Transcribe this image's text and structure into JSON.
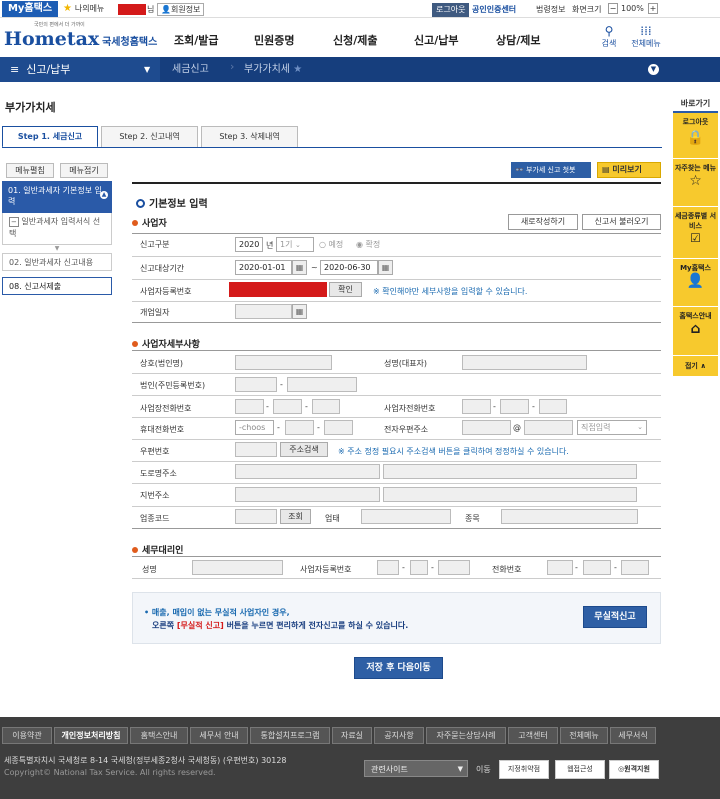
{
  "topbar": {
    "mytax": "My홈택스",
    "mymenu": "나의메뉴",
    "user_suffix": "님",
    "member_info": "회원정보",
    "logout": "로그아웃",
    "cert_center": "공인인증센터",
    "prev_info": "법령정보",
    "screen_size": "화면크기",
    "zoom": "100%"
  },
  "logo": {
    "tagline": "국민의 편에서 더 가까이",
    "brand": "Hometax",
    "org": "국세청홈택스"
  },
  "main_nav": [
    "조회/발급",
    "민원증명",
    "신청/제출",
    "신고/납부",
    "상담/제보"
  ],
  "util": {
    "search": "검색",
    "all_menu": "전체메뉴"
  },
  "breadcrumb": {
    "menu_icon": "≡",
    "level1": "신고/납부",
    "level2": "세금신고",
    "level3": "부가가치세"
  },
  "page_title": "부가가치세",
  "tabs": [
    "Step 1. 세금신고",
    "Step 2. 신고내역",
    "Step 3. 삭제내역"
  ],
  "side": {
    "expand": "메뉴펼침",
    "collapse": "메뉴접기",
    "items": [
      "01. 일반과세자 기본정보 입력",
      "일반과세자 입력서식 선택",
      "02. 일반과세자 신고내용",
      "08. 신고서제출"
    ]
  },
  "actions": {
    "guide": "부가세 신고 첫봇",
    "preview": "미리보기"
  },
  "basic": {
    "title": "기본정보 입력",
    "business_title": "사업자",
    "new_write": "새로작성하기",
    "load_report": "신고서 불러오기",
    "report_type_label": "신고구분",
    "year": "2020",
    "year_unit": "년",
    "period": "1기",
    "opt_preliminary": "예정",
    "opt_final": "확정",
    "target_period_label": "신고대상기간",
    "date_from": "2020-01-01",
    "date_sep": "~",
    "date_to": "2020-06-30",
    "bizno_label": "사업자등록번호",
    "confirm": "확인",
    "bizno_note": "※ 확인해야만 세부사항을 입력할 수 있습니다.",
    "open_date_label": "개업일자"
  },
  "detail": {
    "title": "사업자세부사항",
    "company_name": "상호(법인명)",
    "rep_name": "성명(대표자)",
    "corp_no": "법인(주민등록번호)",
    "biz_phone": "사업장전화번호",
    "home_phone": "사업자전화번호",
    "mobile": "휴대전화번호",
    "mobile_placeholder": "-choos",
    "email": "전자우편주소",
    "email_at": "@",
    "email_select": "직접입력",
    "zip": "우편번호",
    "addr_search": "주소검색",
    "zip_note": "※ 주소 정정 필요시 주소검색 버튼을 클릭하여 정정하실 수 있습니다.",
    "road_addr": "도로명주소",
    "lot_addr": "지번주소",
    "industry_code": "업종코드",
    "lookup": "조회",
    "business_type": "업태",
    "item": "종목"
  },
  "agent": {
    "title": "세무대리인",
    "name": "성명",
    "bizno": "사업자등록번호",
    "phone": "전화번호"
  },
  "notice": {
    "line1": "• 매출, 매입이 없는 무실적 사업자인 경우,",
    "line2a": "오른쪽 ",
    "line2b": "[무실적 신고]",
    "line2c": " 버튼을 누르면 편리하게 전자신고를 하실 수 있습니다.",
    "no_result_btn": "무실적신고"
  },
  "save_next": "저장 후 다음이동",
  "right_panel": {
    "title": "바로가기",
    "logout": "로그아웃",
    "faq": "자주찾는 메뉴",
    "tax_service": "세금종류별 서비스",
    "mytax": "My홈택스",
    "guide": "홈택스안내",
    "fold": "접기"
  },
  "footer": {
    "links": [
      "이용약관",
      "개인정보처리방침",
      "홈택스안내",
      "세무서 안내",
      "통합설치프로그램",
      "자료실",
      "공지사항",
      "자주묻는상담사례",
      "고객센터",
      "전체메뉴",
      "세무서식"
    ],
    "address": "세종특별자치시 국세청로 8-14 국세청(정부세종2청사 국세청동) (우편번호) 30128",
    "copyright": "Copyright© National Tax Service. All rights reserved.",
    "related": "관련사이트",
    "go": "이동",
    "badge1": "지정취약점",
    "badge2": "웹접근성",
    "badge3": "원격지원"
  },
  "colors": {
    "primary": "#1a4fa0",
    "nav": "#163e7d",
    "accent": "#f7c92d",
    "footer": "#3e3e3e",
    "red": "#d41a1a"
  }
}
